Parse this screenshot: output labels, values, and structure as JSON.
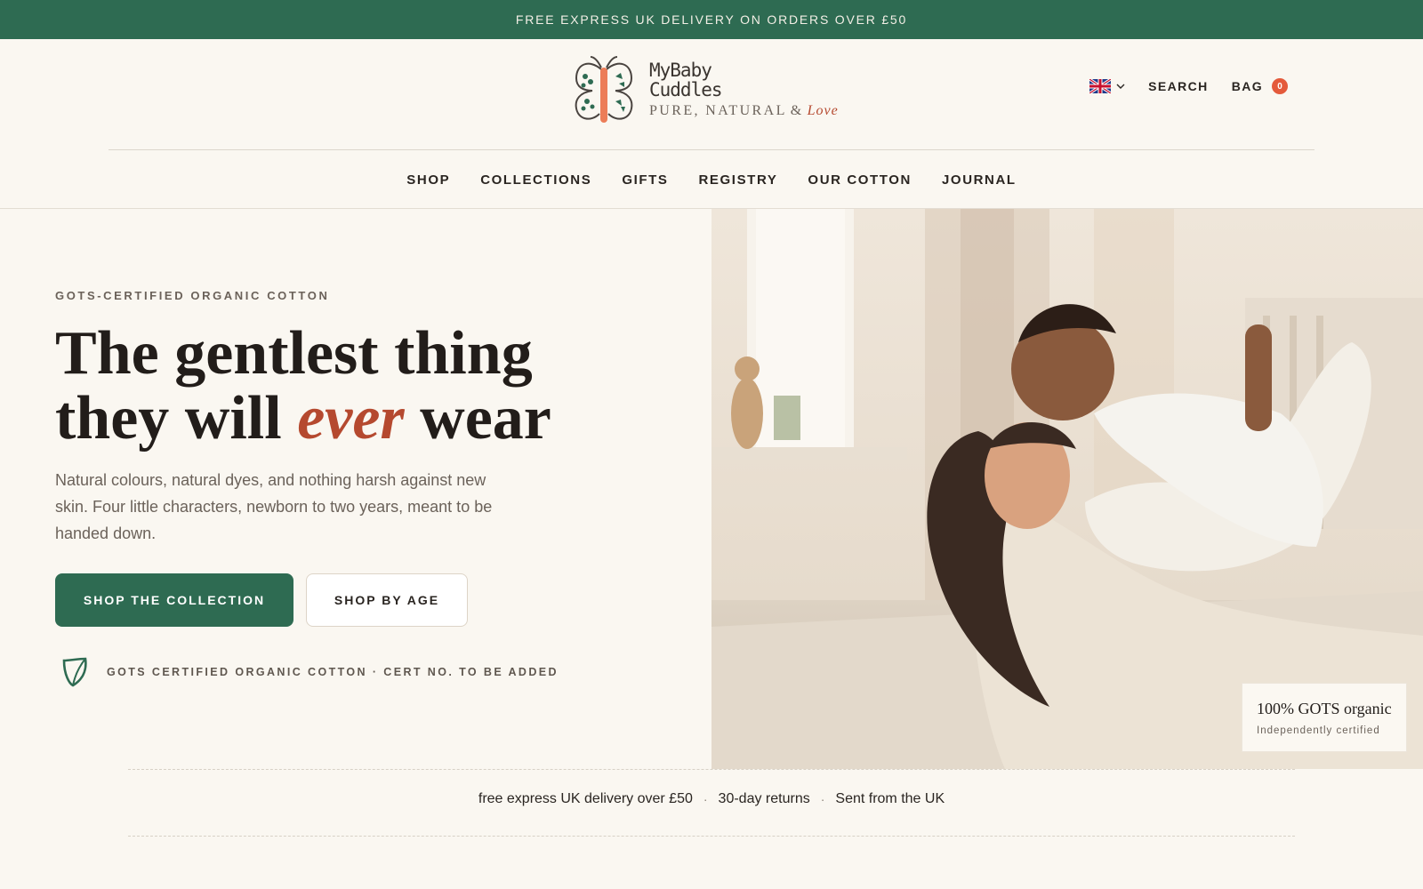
{
  "announcement": {
    "text": "FREE EXPRESS UK DELIVERY ON ORDERS OVER £50"
  },
  "brand": {
    "name_line1": "MyBaby",
    "name_line2": "Cuddles",
    "tagline_main": "PURE, NATURAL",
    "tagline_amp": "&",
    "tagline_love": "Love"
  },
  "header": {
    "locale_icon": "uk-flag-icon",
    "search_label": "SEARCH",
    "bag_label": "BAG",
    "bag_count": "0"
  },
  "nav": {
    "items": [
      {
        "label": "SHOP"
      },
      {
        "label": "COLLECTIONS"
      },
      {
        "label": "GIFTS"
      },
      {
        "label": "REGISTRY"
      },
      {
        "label": "OUR COTTON"
      },
      {
        "label": "JOURNAL"
      }
    ]
  },
  "hero": {
    "eyebrow": "GOTS-CERTIFIED ORGANIC COTTON",
    "headline_line1": "The gentlest thing",
    "headline_line2_start": "they will",
    "headline_emphasis": "ever",
    "headline_line2_end": "wear",
    "subcopy": "Natural colours, natural dyes, and nothing harsh against new skin. Four little characters, newborn to two years, meant to be handed down.",
    "primary_cta": "SHOP THE COLLECTION",
    "secondary_cta": "SHOP BY AGE",
    "cert_text": "GOTS CERTIFIED ORGANIC COTTON · CERT NO. TO BE ADDED",
    "cert_icon": "leaf-icon",
    "image_alt": "mother-lifting-baby-photo",
    "badge_title": "100% GOTS organic",
    "badge_subtitle": "Independently certified"
  },
  "trust_bar": {
    "items": [
      "free express UK delivery over £50",
      "30-day returns",
      "Sent from the UK"
    ],
    "separator": "·"
  },
  "colors": {
    "brand_green": "#2e6b52",
    "accent_terracotta": "#b5492f",
    "background": "#faf7f1",
    "bag_badge": "#e45a3b"
  }
}
